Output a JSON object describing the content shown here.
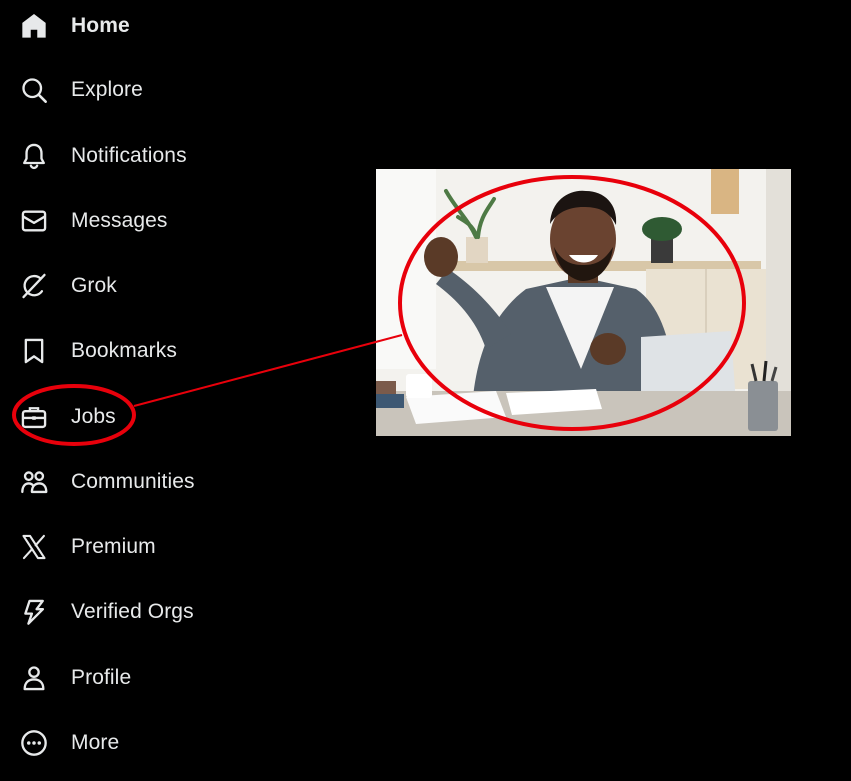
{
  "nav": {
    "items": [
      {
        "label": "Home",
        "icon": "home-icon",
        "active": true
      },
      {
        "label": "Explore",
        "icon": "search-icon",
        "active": false
      },
      {
        "label": "Notifications",
        "icon": "bell-icon",
        "active": false
      },
      {
        "label": "Messages",
        "icon": "envelope-icon",
        "active": false
      },
      {
        "label": "Grok",
        "icon": "grok-icon",
        "active": false
      },
      {
        "label": "Bookmarks",
        "icon": "bookmark-icon",
        "active": false
      },
      {
        "label": "Jobs",
        "icon": "briefcase-icon",
        "active": false
      },
      {
        "label": "Communities",
        "icon": "people-icon",
        "active": false
      },
      {
        "label": "Premium",
        "icon": "x-logo-icon",
        "active": false
      },
      {
        "label": "Verified Orgs",
        "icon": "lightning-icon",
        "active": false
      },
      {
        "label": "Profile",
        "icon": "person-icon",
        "active": false
      },
      {
        "label": "More",
        "icon": "more-circle-icon",
        "active": false
      }
    ]
  },
  "annotation": {
    "highlight_color": "#e8000b",
    "photo_subject": "excited-man-at-laptop"
  },
  "colors": {
    "background": "#000000",
    "text": "#e7e9ea"
  }
}
